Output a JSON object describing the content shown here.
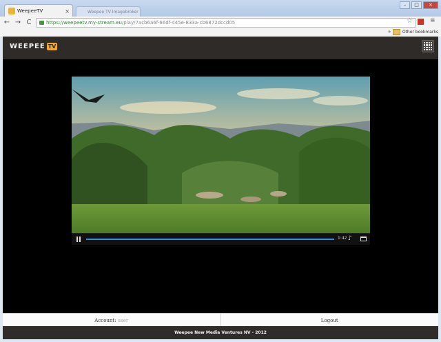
{
  "browser": {
    "tab_title": "WeepeeTV",
    "tab2_title": "Weepee TV Imagebroker",
    "url_host": "https://weepeetv.my-stream.eu",
    "url_path": "/play/7acb6a6f-66df-445e-833a-cb6872dccd05",
    "bookmarks_folder": "Other bookmarks",
    "bookmarks_chevron": "»",
    "tab_close": "×",
    "back_icon": "←",
    "forward_icon": "→",
    "reload_icon": "C",
    "star_icon": "☆",
    "menu_icon": "≡"
  },
  "site": {
    "logo_text": "WEEPEE",
    "logo_badge": "TV",
    "accent_color": "#f0a830",
    "header_color": "#2e2b28"
  },
  "player": {
    "time_label": "1:42",
    "progress_fraction": 1.0,
    "pause_icon": "pause-icon",
    "volume_icon": "♪",
    "fullscreen_icon": "fullscreen-icon"
  },
  "footer": {
    "account_label": "Account:",
    "account_user": "user",
    "logout_label": "Logout",
    "copyright": "Weepee New Media Ventures NV - 2012"
  }
}
